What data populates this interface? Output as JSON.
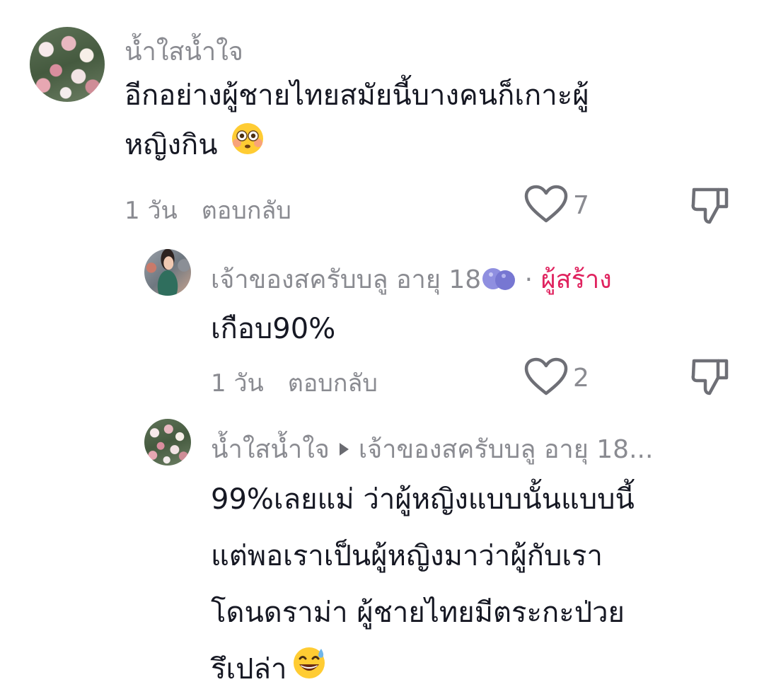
{
  "comments": [
    {
      "username": "น้ำใสน้ำใจ",
      "text_line1": "อีกอย่างผู้ชายไทยสมัยนี้บางคนก็เกาะผู้",
      "text_line2": "หญิงกิน",
      "emoji": "flushed-face-emoji",
      "time": "1 วัน",
      "reply_label": "ตอบกลับ",
      "likes": "7"
    },
    {
      "username": "เจ้าของสครับบลู อายุ 18",
      "username_emoji": "blueberries-emoji",
      "separator": "·",
      "creator_label": "ผู้สร้าง",
      "text": "เกือบ90%",
      "time": "1 วัน",
      "reply_label": "ตอบกลับ",
      "likes": "2"
    },
    {
      "username": "น้ำใสน้ำใจ",
      "reply_to": "เจ้าของสครับบลู อายุ 18...",
      "text_line1": "99%เลยแม่ ว่าผู้หญิงแบบนั้นแบบนี้",
      "text_line2": "แต่พอเราเป็นผู้หญิงมาว่าผู้กับเรา",
      "text_line3": "โดนดราม่า ผู้ชายไทยมีตระกะป่วย",
      "text_line4": "รึเปล่า",
      "emoji": "grinning-sweat-emoji"
    }
  ],
  "icons": {
    "like": "heart-outline-icon",
    "dislike": "thumbs-down-outline-icon",
    "reply_arrow": "caret-right-icon"
  },
  "colors": {
    "text": "#161823",
    "muted": "#8a8b91",
    "creator": "#e0235f"
  }
}
